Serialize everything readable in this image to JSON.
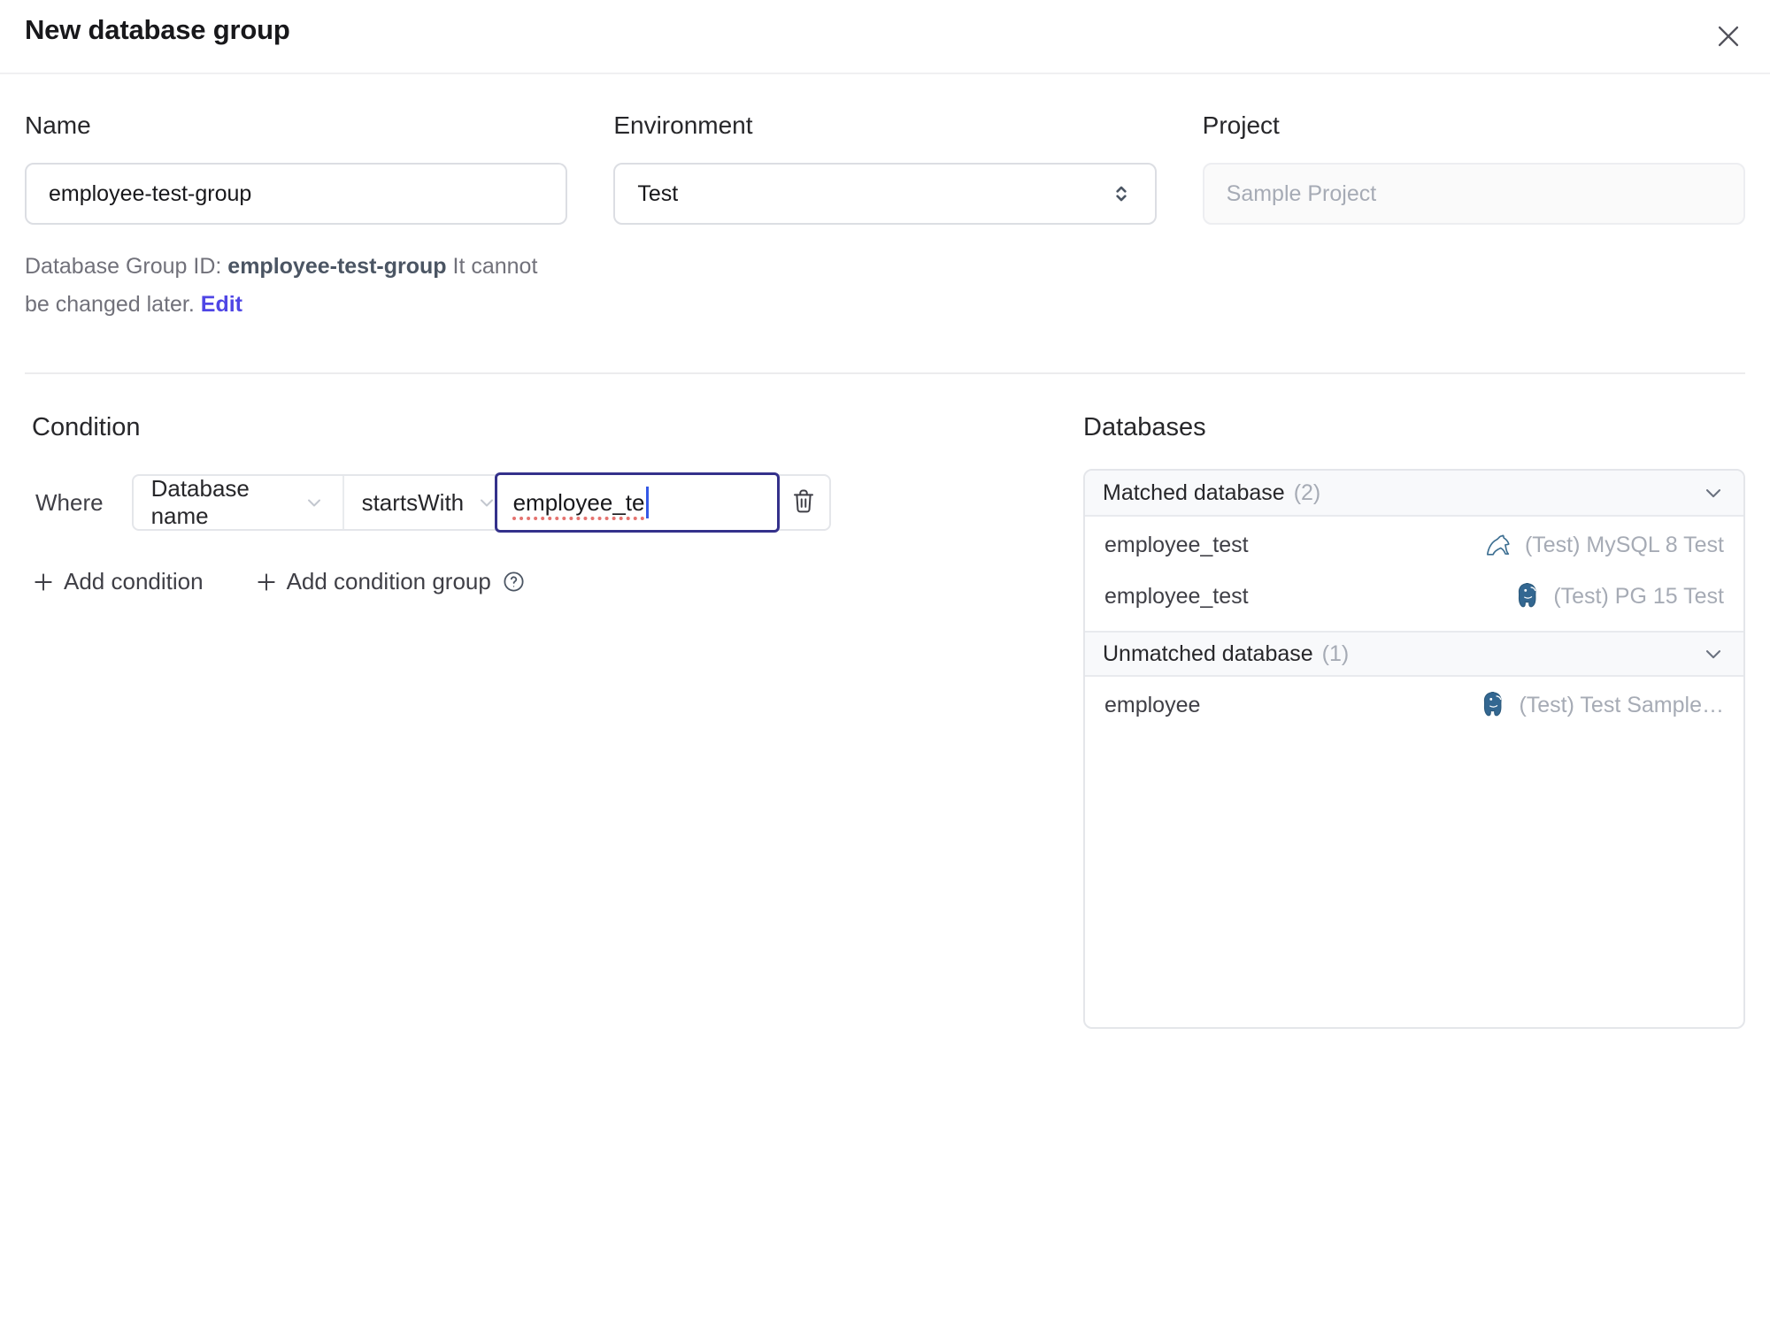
{
  "dialog": {
    "title": "New database group"
  },
  "form": {
    "name": {
      "label": "Name",
      "value": "employee-test-group"
    },
    "environment": {
      "label": "Environment",
      "value": "Test"
    },
    "project": {
      "label": "Project",
      "value": "Sample Project"
    },
    "id_hint": {
      "prefix": "Database Group ID: ",
      "id": "employee-test-group",
      "suffix": " It cannot be changed later. ",
      "edit_label": "Edit"
    }
  },
  "condition": {
    "heading": "Condition",
    "where_label": "Where",
    "factor": "Database name",
    "operator": "startsWith",
    "value": "employee_te",
    "add_condition_label": "Add condition",
    "add_condition_group_label": "Add condition group"
  },
  "databases": {
    "heading": "Databases",
    "groups": [
      {
        "title": "Matched database",
        "count": "(2)",
        "rows": [
          {
            "name": "employee_test",
            "icon": "mysql-icon",
            "instance": "(Test) MySQL 8 Test"
          },
          {
            "name": "employee_test",
            "icon": "postgres-icon",
            "instance": "(Test) PG 15 Test"
          }
        ]
      },
      {
        "title": "Unmatched database",
        "count": "(1)",
        "rows": [
          {
            "name": "employee",
            "icon": "postgres-icon",
            "instance": "(Test) Test Sample…"
          }
        ]
      }
    ]
  },
  "icons": {
    "close": "x-icon",
    "environment": "up-down-chevron-icon",
    "dropdown": "chevron-down-icon",
    "delete_condition": "trash-icon",
    "add": "plus-icon",
    "help": "question-circle-icon",
    "collapse": "chevron-down-icon"
  },
  "colors": {
    "accent_link": "#4f46e5",
    "focused_input_border": "#34318b",
    "caret_blue": "#3459e6",
    "spellcheck_red": "#e5736f",
    "header_bg": "#f8f9fb",
    "muted_text": "#a6abb5",
    "mysql_blue": "#3c6e91",
    "postgres_blue": "#336791"
  }
}
